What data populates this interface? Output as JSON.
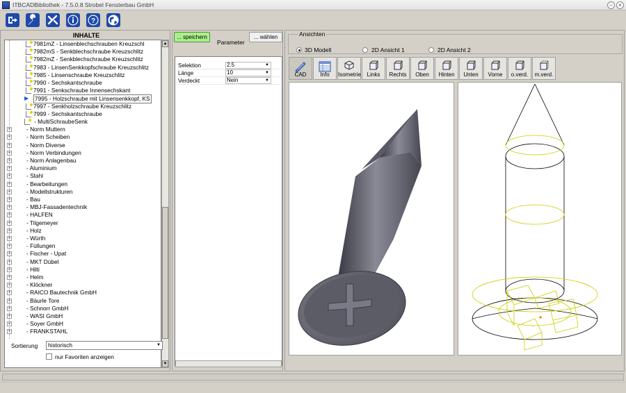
{
  "window": {
    "title": "ITBCADBibliothek - 7.5.0.8 Strobel Fensterbau GmbH"
  },
  "toolbar": {
    "icons": [
      "exit-icon",
      "wrench-icon",
      "tools-icon",
      "info-icon",
      "help-icon",
      "globe-icon"
    ],
    "colors": {
      "button_bg": "#1f4aa8"
    }
  },
  "left": {
    "header": "INHALTE",
    "tree_items": [
      "7981mZ - Linsenblechschrauben Kreuzschl",
      "7982mS - Senkblechschraube Kreuzschlitz",
      "7982mZ - Senkblechschraube Kreuzschlitz",
      "7983 - LinsenSenkkopfschraube Kreuzschlitz",
      "7985 - Linsenschraube Kreuzschlitz",
      "7990 - Sechskantschraube",
      "7991 - Senkschraube Innensechskant",
      "7995 - Holzschraube mit Linsensenkkopf, KS",
      "7997 - Senkholzschraube Kreuzschlitz",
      "7999 - Sechskantschraube",
      "- MultiSchraubeSenk"
    ],
    "groups": [
      "- Norm Muttern",
      "- Norm Scheiben",
      "- Norm Diverse",
      "- Norm Verbindungen",
      "- Norm Anlagenbau",
      "- Aluminium",
      "- Stahl",
      "- Bearbeitungen",
      "- Modellstrukturen",
      "- Bau",
      "- MBJ-Fassadentechnik",
      "- HALFEN",
      "- Tilgemeyer",
      "- Holz",
      "- Würth",
      "- Füllungen",
      "- Fischer - Upat",
      "- MKT Dübel",
      "- Hilti",
      "- Helm",
      "- Klöckner",
      "- RAICO Bautechnik GmbH",
      "- Bäurle Tore",
      "- Schnorr GmbH",
      "- WASI GmbH",
      "- Soyer GmbH",
      "- FRANKSTAHL"
    ],
    "sort_label": "Sortierung",
    "sort_value": "historisch",
    "favorites_label": "nur Favoriten anzeigen"
  },
  "middle": {
    "save_label": "... speichern",
    "param_label": "Parameter",
    "choose_label": "... wählen",
    "params": [
      {
        "key": "Selektion",
        "value": "2.5"
      },
      {
        "key": "Länge",
        "value": "10"
      },
      {
        "key": "Verdeckt",
        "value": "Nein"
      }
    ]
  },
  "right": {
    "group_title": "Ansichten",
    "radio": [
      "3D Modell",
      "2D Ansicht 1",
      "2D Ansicht 2"
    ],
    "view_buttons": [
      "CAD",
      "Info",
      "Isometrie",
      "Links",
      "Rechts",
      "Oben",
      "Hinten",
      "Unten",
      "Vorne",
      "o.verd.",
      "m.verd."
    ]
  }
}
